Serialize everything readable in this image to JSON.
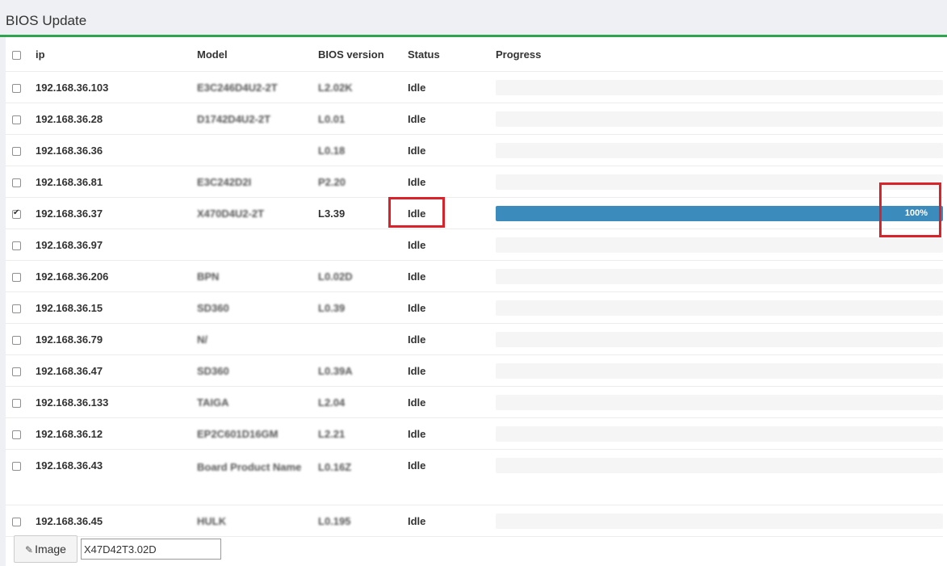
{
  "panel": {
    "title": "BIOS Update"
  },
  "table": {
    "headers": {
      "ip": "ip",
      "model": "Model",
      "bios": "BIOS version",
      "status": "Status",
      "progress": "Progress"
    },
    "rows": [
      {
        "ip": "192.168.36.103",
        "model": "E3C246D4U2-2T",
        "bios": "L2.02K",
        "status": "Idle",
        "checked": false,
        "progress": 0
      },
      {
        "ip": "192.168.36.28",
        "model": "D1742D4U2-2T",
        "bios": "L0.01",
        "status": "Idle",
        "checked": false,
        "progress": 0
      },
      {
        "ip": "192.168.36.36",
        "model": "",
        "bios": "L0.18",
        "status": "Idle",
        "checked": false,
        "progress": 0
      },
      {
        "ip": "192.168.36.81",
        "model": "E3C242D2I",
        "bios": "P2.20",
        "status": "Idle",
        "checked": false,
        "progress": 0
      },
      {
        "ip": "192.168.36.37",
        "model": "X470D4U2-2T",
        "bios": "L3.39",
        "status": "Idle",
        "checked": true,
        "progress": 100,
        "progress_label": "100%"
      },
      {
        "ip": "192.168.36.97",
        "model": "",
        "bios": "",
        "status": "Idle",
        "checked": false,
        "progress": 0
      },
      {
        "ip": "192.168.36.206",
        "model": "BPN",
        "bios": "L0.02D",
        "status": "Idle",
        "checked": false,
        "progress": 0
      },
      {
        "ip": "192.168.36.15",
        "model": "SD360",
        "bios": "L0.39",
        "status": "Idle",
        "checked": false,
        "progress": 0
      },
      {
        "ip": "192.168.36.79",
        "model": "N/",
        "bios": "",
        "status": "Idle",
        "checked": false,
        "progress": 0
      },
      {
        "ip": "192.168.36.47",
        "model": "SD360",
        "bios": "L0.39A",
        "status": "Idle",
        "checked": false,
        "progress": 0
      },
      {
        "ip": "192.168.36.133",
        "model": "TAIGA",
        "bios": "L2.04",
        "status": "Idle",
        "checked": false,
        "progress": 0
      },
      {
        "ip": "192.168.36.12",
        "model": "EP2C601D16GM",
        "bios": "L2.21",
        "status": "Idle",
        "checked": false,
        "progress": 0
      },
      {
        "ip": "192.168.36.43",
        "model": "Board Product Name",
        "bios": "L0.16Z",
        "status": "Idle",
        "checked": false,
        "progress": 0
      },
      {
        "ip": "192.168.36.45",
        "model": "HULK",
        "bios": "L0.195",
        "status": "Idle",
        "checked": false,
        "progress": 0
      }
    ]
  },
  "footer": {
    "image_button_label": "Image",
    "image_value": "X47D42T3.02D"
  },
  "icons": {
    "image_button": "pencil-icon"
  },
  "colors": {
    "accent": "#2ea44f",
    "progress_fill": "#3b8bbd",
    "highlight": "#d9222a"
  }
}
